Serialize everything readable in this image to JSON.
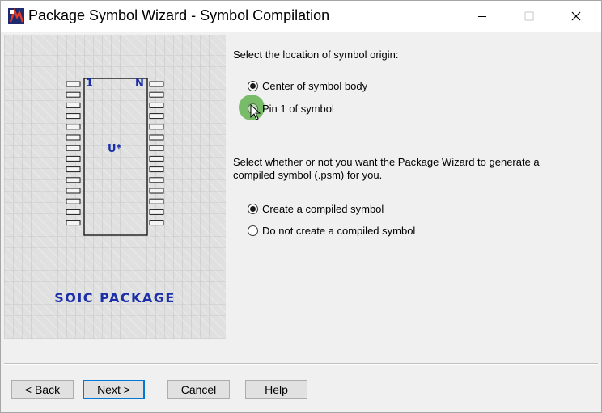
{
  "window": {
    "title": "Package Symbol Wizard - Symbol Compilation"
  },
  "illustration": {
    "pin1_label": "1",
    "pinN_label": "N",
    "refdes": "U*",
    "package_label": "SOIC PACKAGE"
  },
  "origin": {
    "prompt": "Select the location of symbol origin:",
    "options": [
      {
        "label": "Center of symbol body",
        "checked": true
      },
      {
        "label": "Pin 1 of symbol",
        "checked": false
      }
    ]
  },
  "compile": {
    "prompt_line1": "Select whether or not you want the Package Wizard to generate a",
    "prompt_line2": "compiled symbol (.psm) for you.",
    "options": [
      {
        "label": "Create a compiled symbol",
        "checked": true
      },
      {
        "label": "Do not create a compiled symbol",
        "checked": false
      }
    ]
  },
  "buttons": {
    "back": "< Back",
    "next": "Next >",
    "cancel": "Cancel",
    "help": "Help"
  },
  "colors": {
    "package_label": "#1a2fa8",
    "pin_labels": "#1a2fa8",
    "cursor_highlight": "#50aa3c"
  }
}
